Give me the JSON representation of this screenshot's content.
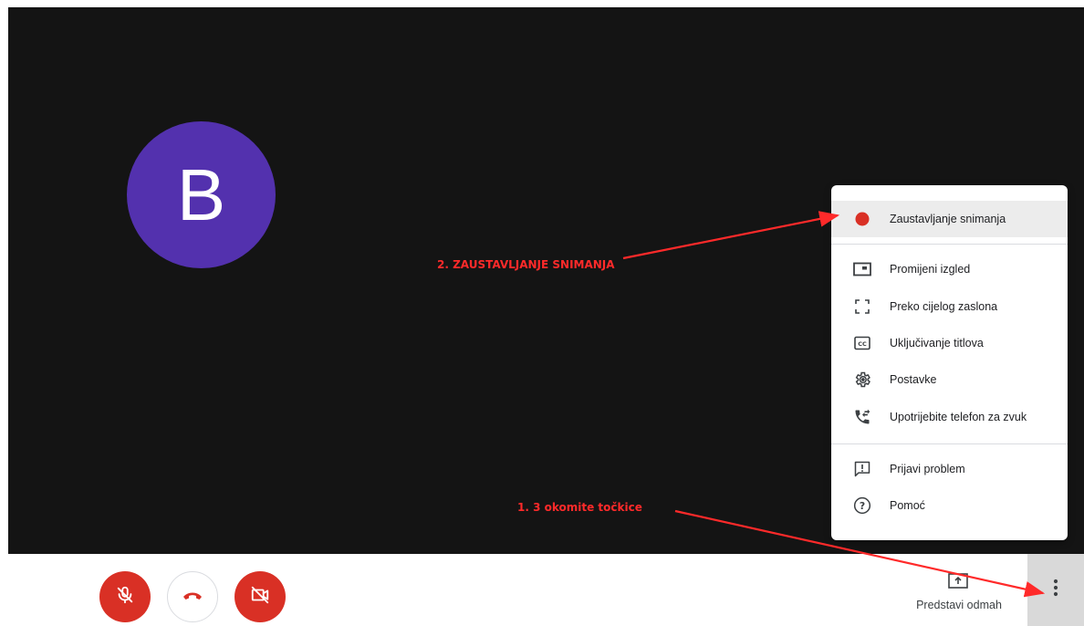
{
  "avatar": {
    "initial": "B",
    "color": "#5331ae"
  },
  "menu": {
    "items": [
      {
        "label": "Zaustavljanje snimanja",
        "icon": "record-dot-icon"
      },
      {
        "label": "Promijeni izgled",
        "icon": "layout-icon"
      },
      {
        "label": "Preko cijelog zaslona",
        "icon": "fullscreen-icon"
      },
      {
        "label": "Uključivanje titlova",
        "icon": "captions-icon"
      },
      {
        "label": "Postavke",
        "icon": "settings-gear-icon"
      },
      {
        "label": "Upotrijebite telefon za zvuk",
        "icon": "phone-audio-icon"
      },
      {
        "label": "Prijavi problem",
        "icon": "report-problem-icon"
      },
      {
        "label": "Pomoć",
        "icon": "help-icon"
      }
    ]
  },
  "controls": {
    "mic": {
      "icon": "mic-off-icon",
      "color": "#d93025"
    },
    "hangup": {
      "icon": "hang-up-icon",
      "color": "#d93025"
    },
    "camera": {
      "icon": "camera-off-icon",
      "color": "#d93025"
    },
    "present_label": "Predstavi odmah",
    "more": {
      "icon": "more-vertical-icon"
    }
  },
  "annotations": {
    "step2": "2. ZAUSTAVLJANJE SNIMANJA",
    "step1": "1. 3 okomite točkice",
    "color": "#ff2a2a"
  }
}
